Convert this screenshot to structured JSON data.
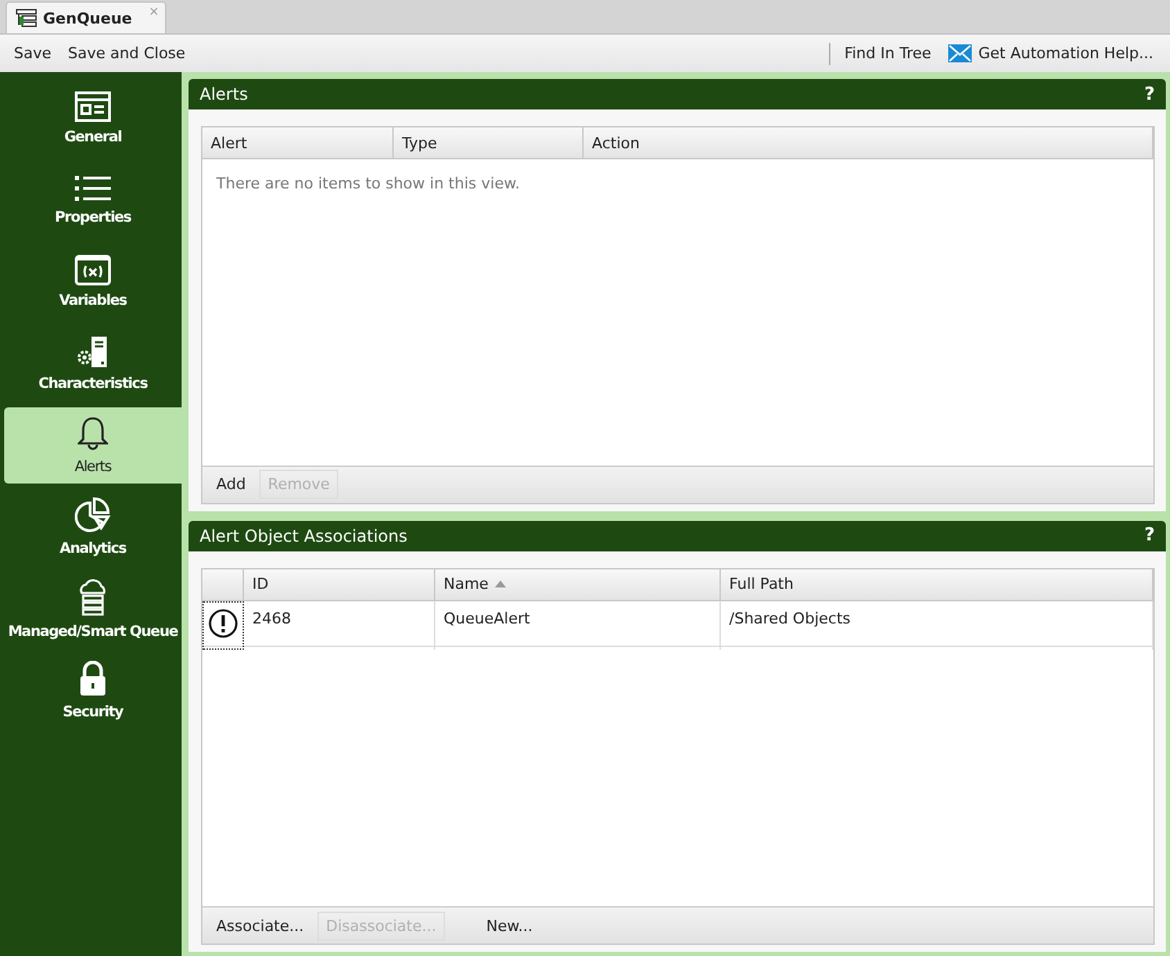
{
  "tab": {
    "title": "GenQueue",
    "close": "×"
  },
  "toolbar": {
    "left": [
      "Save",
      "Save and Close"
    ],
    "right": [
      {
        "label": "Find In Tree",
        "kind": "plain"
      },
      {
        "label": "Get Automation Help...",
        "kind": "mail"
      }
    ]
  },
  "sidebar": {
    "items": [
      {
        "label": "General",
        "selected": false
      },
      {
        "label": "Properties",
        "selected": false
      },
      {
        "label": "Variables",
        "selected": false
      },
      {
        "label": "Characteristics",
        "selected": false
      },
      {
        "label": "Alerts",
        "selected": true
      },
      {
        "label": "Analytics",
        "selected": false
      },
      {
        "label": "Managed/Smart Queue",
        "selected": false
      },
      {
        "label": "Security",
        "selected": false
      }
    ]
  },
  "panels": [
    {
      "title": "Alerts",
      "help": "?",
      "columns": [
        {
          "label": "Alert"
        },
        {
          "label": "Type"
        },
        {
          "label": "Action"
        }
      ],
      "empty_text": "There are no items to show in this view.",
      "buttons": [
        {
          "label": "Add",
          "disabled": false
        },
        {
          "label": "Remove",
          "disabled": true
        }
      ]
    },
    {
      "title": "Alert Object Associations",
      "help": "?",
      "columns": [
        {
          "label": "ID"
        },
        {
          "label": "Name",
          "sorted": true
        },
        {
          "label": "Full Path"
        }
      ],
      "rows": [
        {
          "kind": "alert",
          "cells": [
            "2468",
            "QueueAlert",
            "/Shared Objects"
          ]
        }
      ],
      "buttons": [
        {
          "label": "Associate...",
          "disabled": false
        },
        {
          "label": "Disassociate...",
          "disabled": true
        },
        {
          "label": "New...",
          "disabled": false
        }
      ]
    }
  ]
}
